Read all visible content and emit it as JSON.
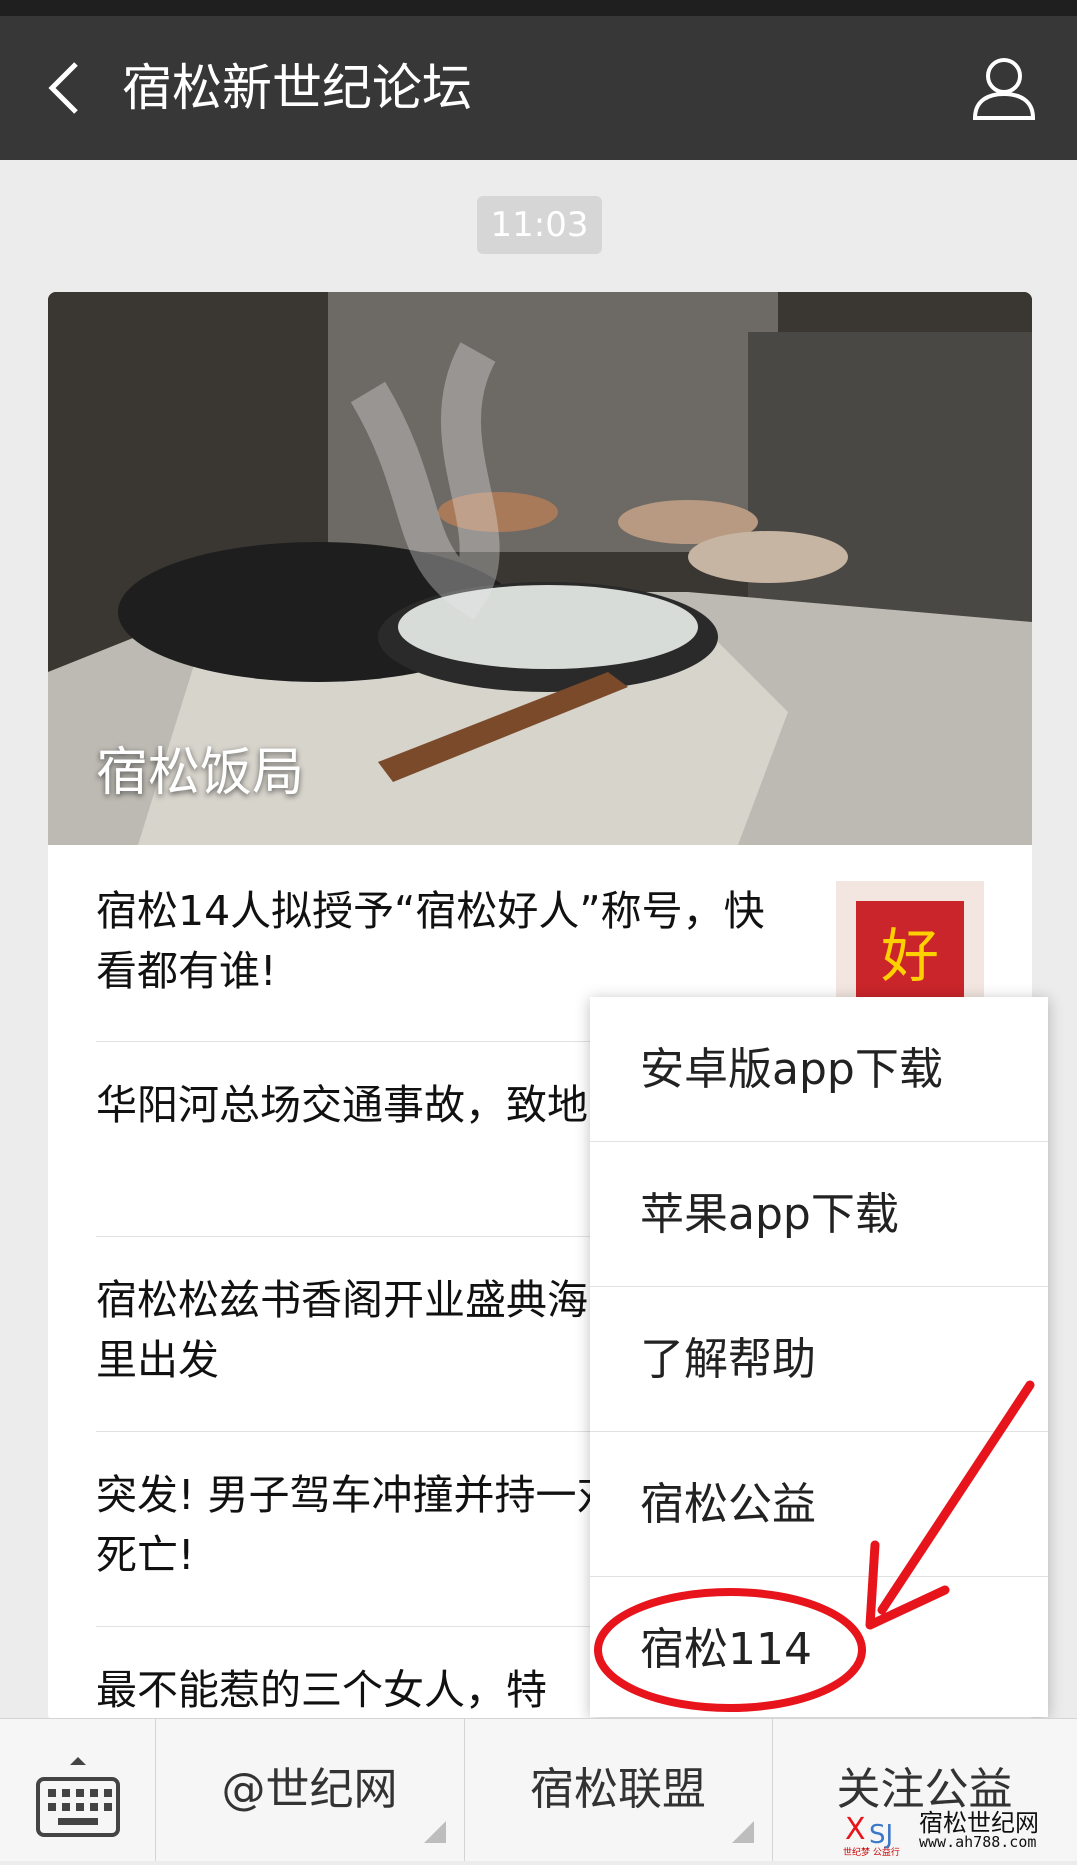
{
  "nav": {
    "title": "宿松新世纪论坛"
  },
  "timestamp": "11:03",
  "cover": {
    "title": "宿松饭局"
  },
  "articles": [
    {
      "title": "宿松14人拟授予“宿松好人”称号，快看都有谁!",
      "thumb_text": "好"
    },
    {
      "title": "华阳河总场交通事故，致地!"
    },
    {
      "title": "宿松松兹书香阁开业盛典海，我们从这里出发"
    },
    {
      "title": "突发! 男子驾车冲撞并持一对夫妻当场死亡!"
    },
    {
      "title": "最不能惹的三个女人，特"
    }
  ],
  "menu": {
    "items": [
      {
        "label": "安卓版app下载"
      },
      {
        "label": "苹果app下载"
      },
      {
        "label": "了解帮助"
      },
      {
        "label": "宿松公益"
      },
      {
        "label": "宿松114"
      }
    ]
  },
  "bottom_tabs": [
    {
      "label": "@世纪网"
    },
    {
      "label": "宿松联盟"
    },
    {
      "label": "关注公益"
    }
  ],
  "watermark": {
    "name": "宿松世纪网",
    "url": "www.ah788.com",
    "slogan": "世纪梦 公益行"
  },
  "colors": {
    "nav_bg": "#373737",
    "highlight": "#e8141c"
  }
}
